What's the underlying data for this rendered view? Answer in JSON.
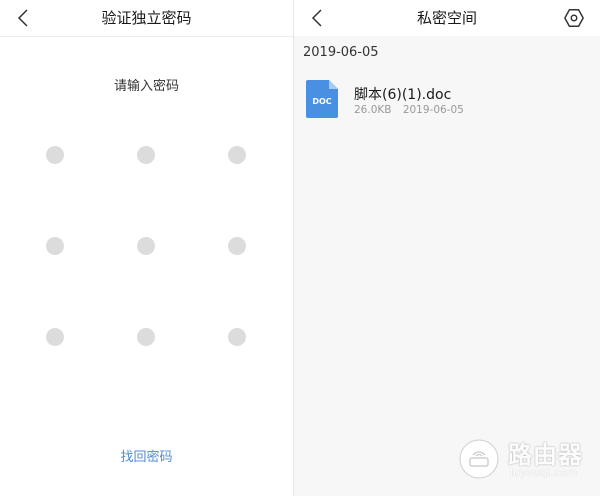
{
  "left": {
    "title": "验证独立密码",
    "prompt": "请输入密码",
    "forgot_label": "找回密码"
  },
  "right": {
    "title": "私密空间",
    "date_header": "2019-06-05",
    "files": [
      {
        "name": "脚本(6)(1).doc",
        "icon_label": "DOC",
        "size": "26.0KB",
        "date": "2019-06-05"
      }
    ]
  },
  "watermark": {
    "text": "路由器",
    "sub": "luyouqi.com"
  },
  "colors": {
    "link": "#4f8bd0",
    "doc_icon": "#4a90e2",
    "dot": "#dcdcdc"
  },
  "icons": [
    "back-arrow-icon",
    "settings-hexagon-icon",
    "doc-file-icon",
    "pattern-dot"
  ]
}
